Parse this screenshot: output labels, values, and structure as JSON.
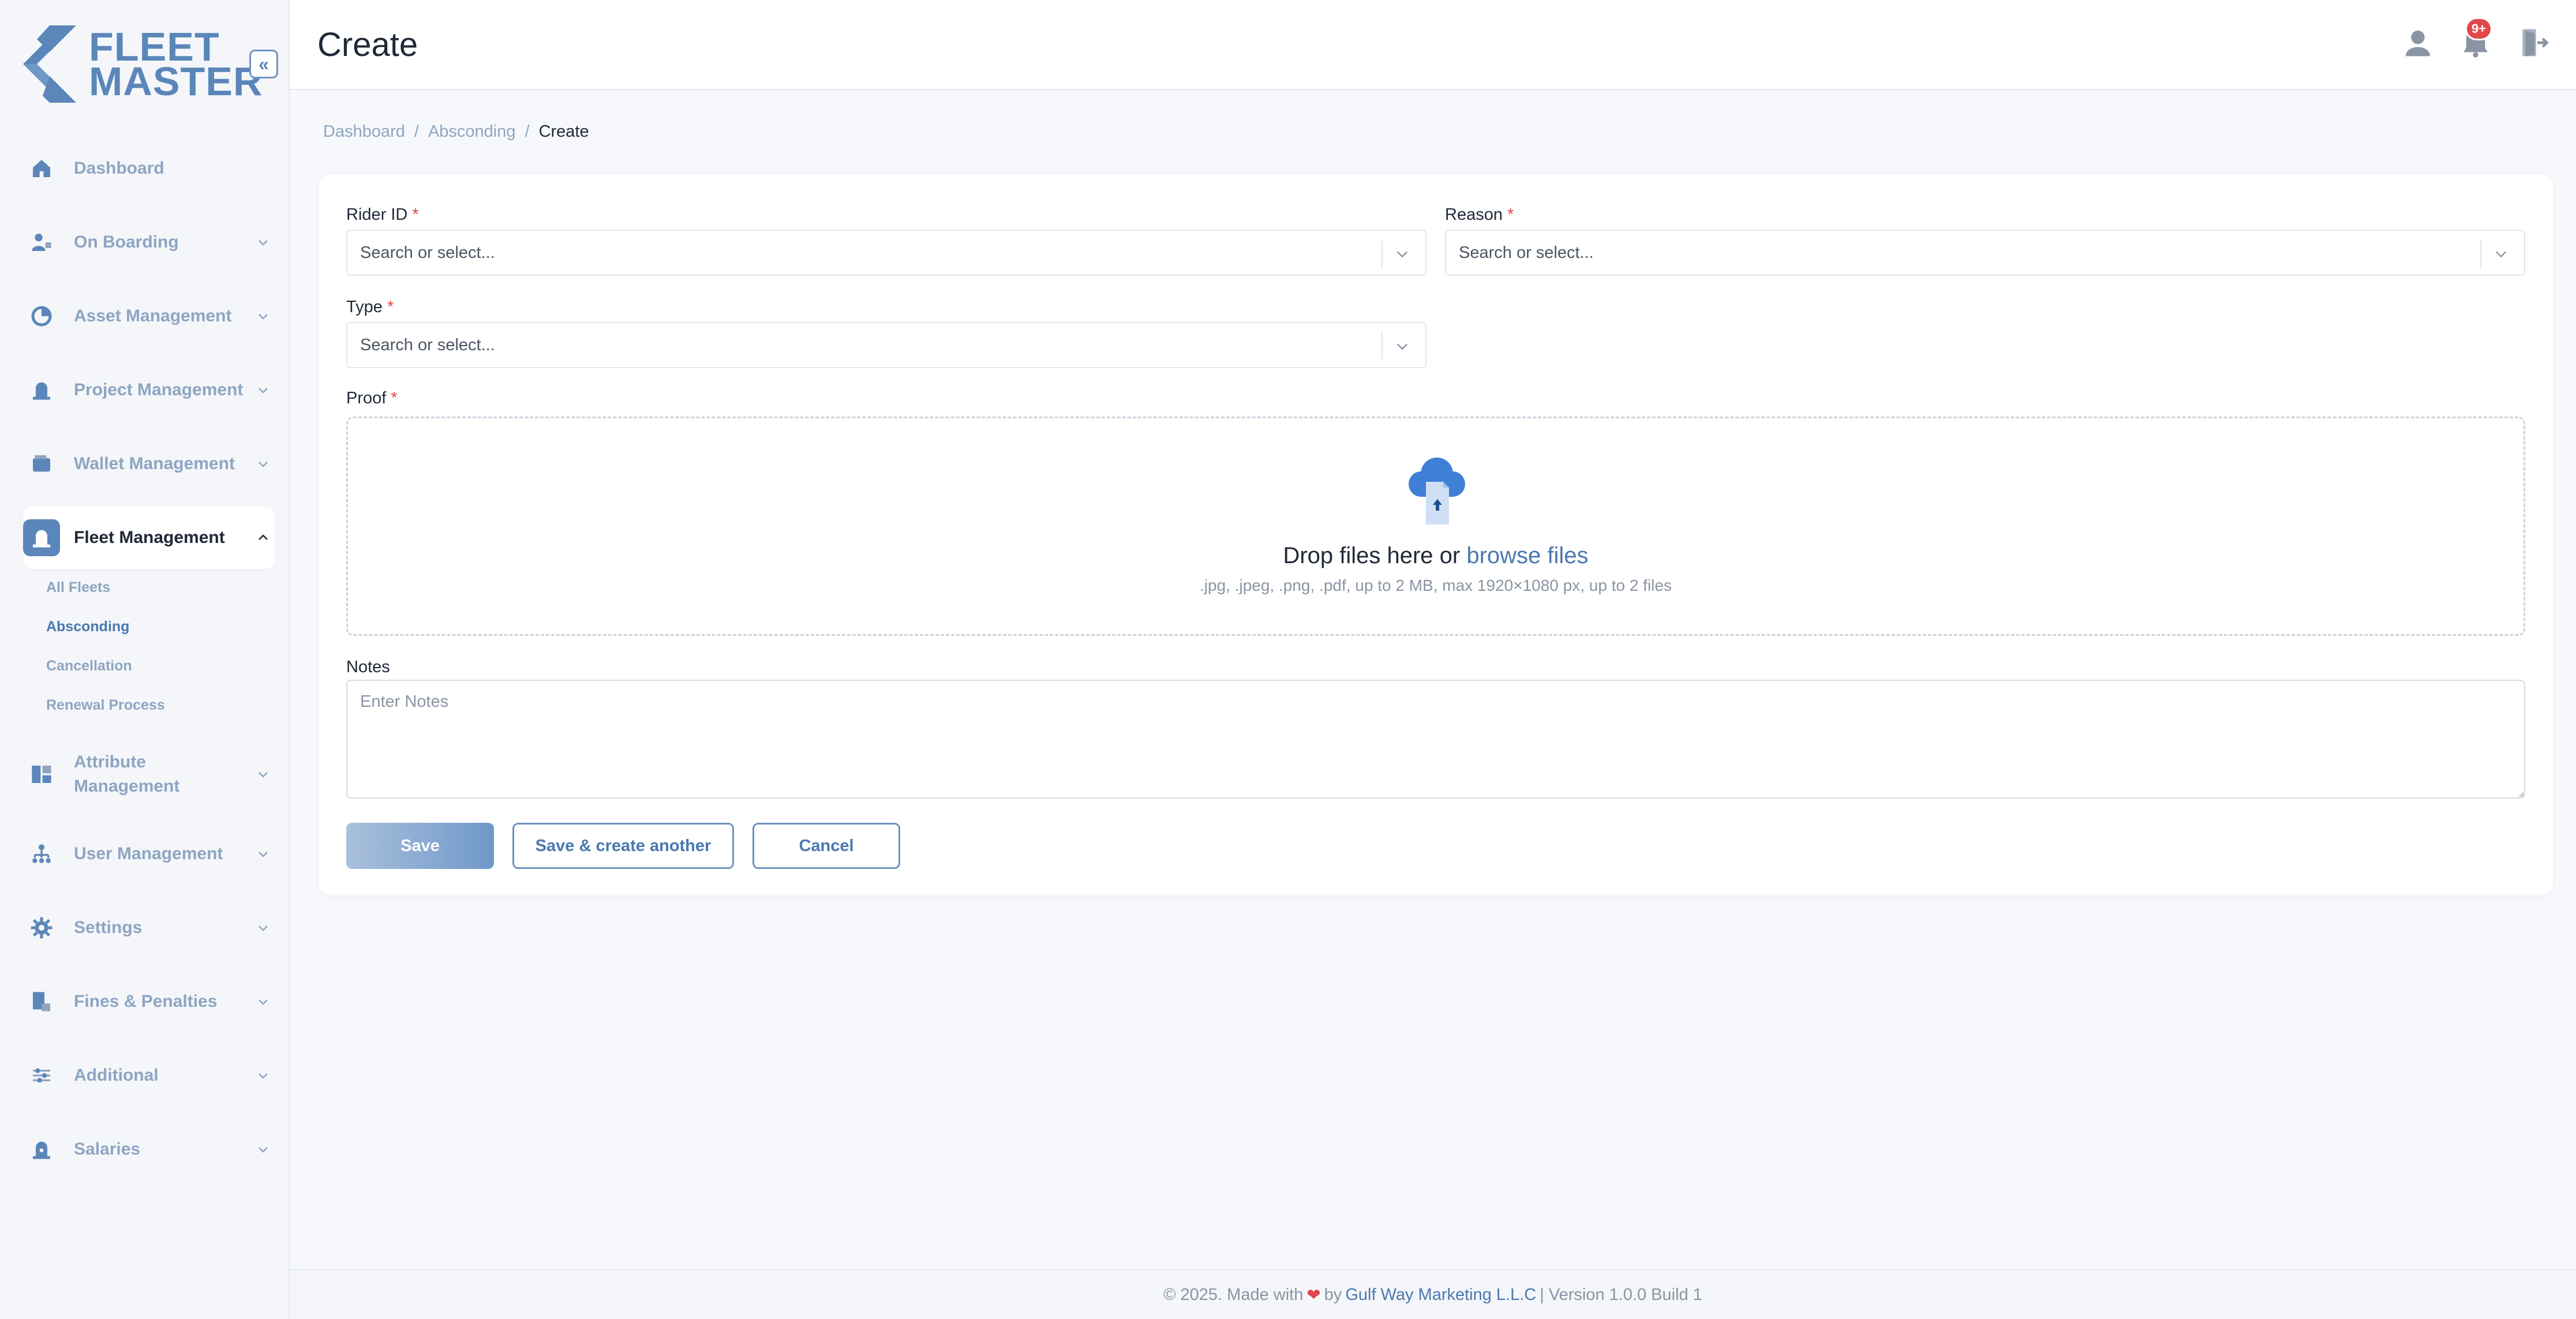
{
  "brand": {
    "line1": "FLEET",
    "line2": "MASTER"
  },
  "header": {
    "title": "Create",
    "notification_badge": "9+",
    "icons": [
      "user-icon",
      "bell-icon",
      "logout-icon"
    ]
  },
  "sidebar": {
    "collapse_icon": "«",
    "items": [
      {
        "label": "Dashboard",
        "icon": "home-icon",
        "has_children": false
      },
      {
        "label": "On Boarding",
        "icon": "onboarding-icon",
        "has_children": true
      },
      {
        "label": "Asset Management",
        "icon": "asset-icon",
        "has_children": true
      },
      {
        "label": "Project Management",
        "icon": "project-icon",
        "has_children": true
      },
      {
        "label": "Wallet Management",
        "icon": "wallet-icon",
        "has_children": true
      },
      {
        "label": "Fleet Management",
        "icon": "fleet-icon",
        "has_children": true,
        "expanded": true
      },
      {
        "label": "Attribute Management",
        "icon": "attribute-icon",
        "has_children": true
      },
      {
        "label": "User Management",
        "icon": "user-tree-icon",
        "has_children": true
      },
      {
        "label": "Settings",
        "icon": "gear-icon",
        "has_children": true
      },
      {
        "label": "Fines & Penalties",
        "icon": "fines-icon",
        "has_children": true
      },
      {
        "label": "Additional",
        "icon": "additional-icon",
        "has_children": true
      },
      {
        "label": "Salaries",
        "icon": "salaries-icon",
        "has_children": true
      }
    ],
    "fleet_sub": [
      {
        "label": "All Fleets"
      },
      {
        "label": "Absconding",
        "active": true
      },
      {
        "label": "Cancellation"
      },
      {
        "label": "Renewal Process"
      }
    ]
  },
  "breadcrumb": {
    "items": [
      "Dashboard",
      "Absconding"
    ],
    "current": "Create",
    "separator": "/"
  },
  "form": {
    "rider_id": {
      "label": "Rider ID",
      "required_mark": "*",
      "placeholder": "Search or select..."
    },
    "reason": {
      "label": "Reason",
      "required_mark": "*",
      "placeholder": "Search or select..."
    },
    "type": {
      "label": "Type",
      "required_mark": "*",
      "placeholder": "Search or select..."
    },
    "proof": {
      "label": "Proof",
      "required_mark": "*",
      "drop_text": "Drop files here or",
      "browse_text": "browse files",
      "hint": ".jpg, .jpeg, .png, .pdf, up to 2 MB, max 1920×1080 px, up to 2 files"
    },
    "notes": {
      "label": "Notes",
      "placeholder": "Enter Notes"
    },
    "buttons": {
      "save": "Save",
      "save_another": "Save & create another",
      "cancel": "Cancel"
    }
  },
  "footer": {
    "prefix": "© 2025. Made with",
    "heart": "❤",
    "by": "by",
    "company": "Gulf Way Marketing L.L.C",
    "suffix": "| Version 1.0.0 Build 1"
  },
  "colors": {
    "accent": "#5b86b9",
    "link": "#4a78b0",
    "required": "#e2474a",
    "muted": "#8ea5c2"
  }
}
